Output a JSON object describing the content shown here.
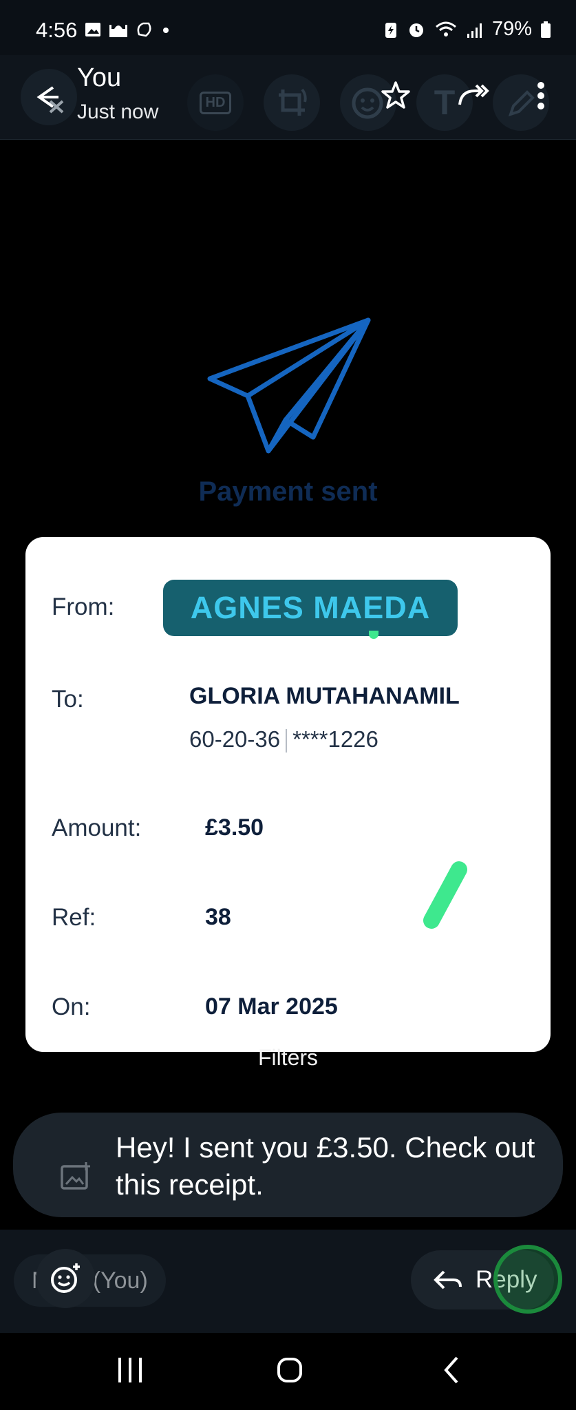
{
  "status_bar": {
    "time": "4:56",
    "battery": "79%"
  },
  "header": {
    "title": "You",
    "subtitle": "Just now",
    "hd_label": "HD",
    "text_tool": "T"
  },
  "receipt": {
    "heading": "Payment sent",
    "from_label": "From:",
    "from_name": "AGNES MAEDA",
    "to_label": "To:",
    "to_name": "GLORIA MUTAHANAMIL",
    "sort_code": "60-20-36",
    "account": "****1226",
    "amount_label": "Amount:",
    "amount": "£3.50",
    "ref_label": "Ref:",
    "ref": "38",
    "on_label": "On:",
    "date": "07 Mar 2025",
    "accent_color": "#1565c0",
    "badge_color": "#16606e",
    "doodle_color": "#3ee88e"
  },
  "filters_label": "Filters",
  "caption": {
    "text": "Hey! I sent you £3.50. Check out this receipt."
  },
  "reply_bar": {
    "recipient_chip": "M Uk (You)",
    "reply_label": "Reply",
    "send_color": "#1b8a3c"
  }
}
